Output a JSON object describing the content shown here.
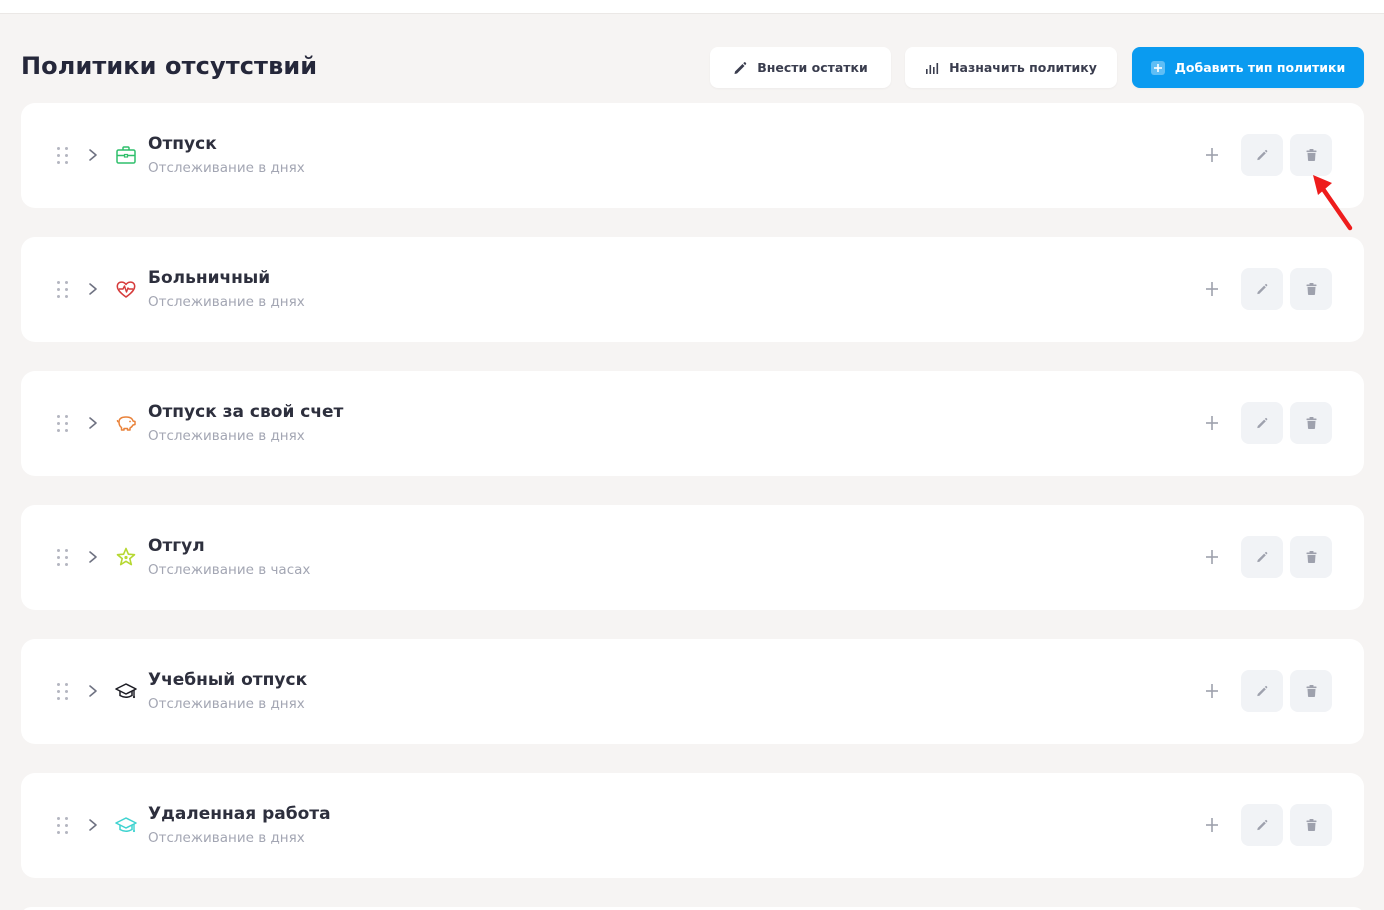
{
  "page": {
    "title": "Политики отсутствий"
  },
  "toolbar": {
    "balance_label": "Внести остатки",
    "assign_label": "Назначить политику",
    "add_label": "Добавить тип политики"
  },
  "colors": {
    "primary": "#0a9bf0",
    "annotation_arrow": "#ee1c1c"
  },
  "policies": [
    {
      "name": "Отпуск",
      "tracking": "Отслеживание в днях",
      "icon": "briefcase-icon",
      "icon_color": "#2fbf6b"
    },
    {
      "name": "Больничный",
      "tracking": "Отслеживание в днях",
      "icon": "heart-pulse-icon",
      "icon_color": "#d63b3b"
    },
    {
      "name": "Отпуск за свой счет",
      "tracking": "Отслеживание в днях",
      "icon": "piggy-bank-icon",
      "icon_color": "#e9823a"
    },
    {
      "name": "Отгул",
      "tracking": "Отслеживание в часах",
      "icon": "star-icon",
      "icon_color": "#b6d832"
    },
    {
      "name": "Учебный отпуск",
      "tracking": "Отслеживание в днях",
      "icon": "graduation-cap-icon",
      "icon_color": "#1c1c24"
    },
    {
      "name": "Удаленная работа",
      "tracking": "Отслеживание в днях",
      "icon": "graduation-cap-icon",
      "icon_color": "#3fd3d0"
    }
  ]
}
